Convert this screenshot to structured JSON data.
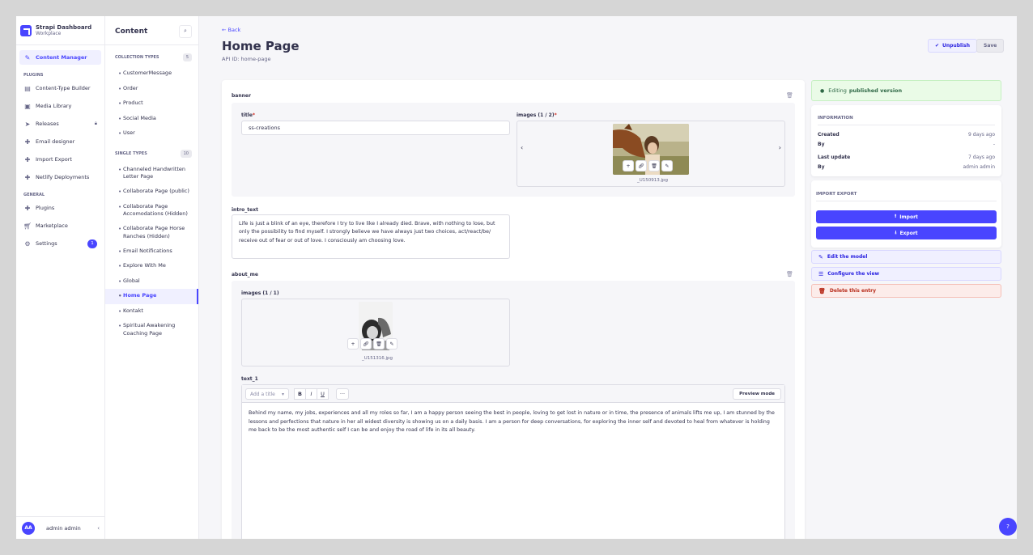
{
  "brand": {
    "name": "Strapi Dashboard",
    "sub": "Workplace"
  },
  "mainnav": {
    "content_manager": "Content Manager",
    "plugins_section": "PLUGINS",
    "plugins": [
      "Content-Type Builder",
      "Media Library",
      "Releases",
      "Email designer",
      "Import Export",
      "Netlify Deployments"
    ],
    "general_section": "GENERAL",
    "general": [
      "Plugins",
      "Marketplace",
      "Settings"
    ],
    "settings_badge": "1"
  },
  "user": {
    "initials": "AA",
    "name": "admin admin"
  },
  "subnav": {
    "title": "Content",
    "collection_label": "COLLECTION TYPES",
    "collection_count": "5",
    "collection": [
      "CustomerMessage",
      "Order",
      "Product",
      "Social Media",
      "User"
    ],
    "single_label": "SINGLE TYPES",
    "single_count": "10",
    "single": [
      "Channeled Handwritten Letter Page",
      "Collaborate Page (public)",
      "Collaborate Page Accomodations (Hidden)",
      "Collaborate Page Horse Ranches (Hidden)",
      "Email Notifications",
      "Explore With Me",
      "Global",
      "Home Page",
      "Kontakt",
      "Spiritual Awakening Coaching Page"
    ]
  },
  "header": {
    "back": "Back",
    "title": "Home Page",
    "api_id": "API ID: home-page",
    "unpublish": "Unpublish",
    "save": "Save"
  },
  "banner": {
    "label": "banner",
    "title_label": "title",
    "title_value": "ss-creations",
    "images_label": "images (1 / 2)",
    "image_file": "_U150913.jpg"
  },
  "intro": {
    "label": "intro_text",
    "value": "Life is just a blink of an eye, therefore I try to live like I already died. Brave, with nothing to lose, but only the possibility to find myself. I strongly believe we have always just two choices, act/react/be/ receive out of fear or out of love. I consciously am choosing love."
  },
  "about": {
    "label": "about_me",
    "images_label": "images (1 / 1)",
    "image_file": "_U151316.jpg",
    "text_label": "text_1",
    "add_title": "Add a title",
    "preview": "Preview mode",
    "text": "Behind my name, my jobs, experiences and all my roles so far, I am a happy person seeing the best in people, loving to get lost in nature or in time, the presence of animals lifts me up, I am stunned by the lessons and perfections that nature in her all widest diversity is showing us on a daily basis. I am a person for deep conversations, for exploring the inner self and devoted to heal from whatever is holding me back to be the most authentic self I can be and enjoy the road of life in its all beauty."
  },
  "status": {
    "editing": "Editing",
    "version": "published version"
  },
  "info": {
    "title": "INFORMATION",
    "created_label": "Created",
    "created_value": "9 days ago",
    "by_label": "By",
    "by_value": "-",
    "updated_label": "Last update",
    "updated_value": "7 days ago",
    "by2_label": "By",
    "by2_value": "admin admin"
  },
  "import_export": {
    "title": "IMPORT EXPORT",
    "import": "Import",
    "export": "Export"
  },
  "actions": {
    "edit_model": "Edit the model",
    "configure_view": "Configure the view",
    "delete": "Delete this entry"
  },
  "colors": {
    "primary": "#4945ff",
    "success_bg": "#eafbe7",
    "danger": "#d02b20"
  }
}
